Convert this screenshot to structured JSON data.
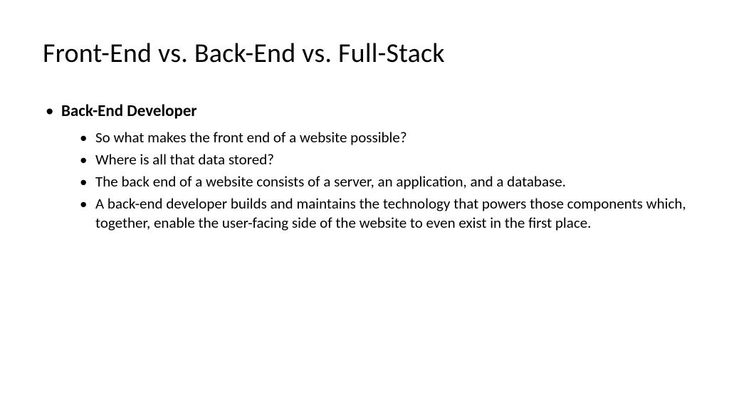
{
  "title": "Front-End vs. Back-End vs. Full-Stack",
  "section": {
    "heading": "Back-End Developer",
    "bullets": [
      "So what makes the front end of a website possible?",
      "Where is all that data stored?",
      "The back end of a website consists of a server, an application, and a database.",
      "A back-end developer builds and maintains the technology that powers those components which, together, enable the user-facing side of the website to even exist in the first place."
    ]
  }
}
